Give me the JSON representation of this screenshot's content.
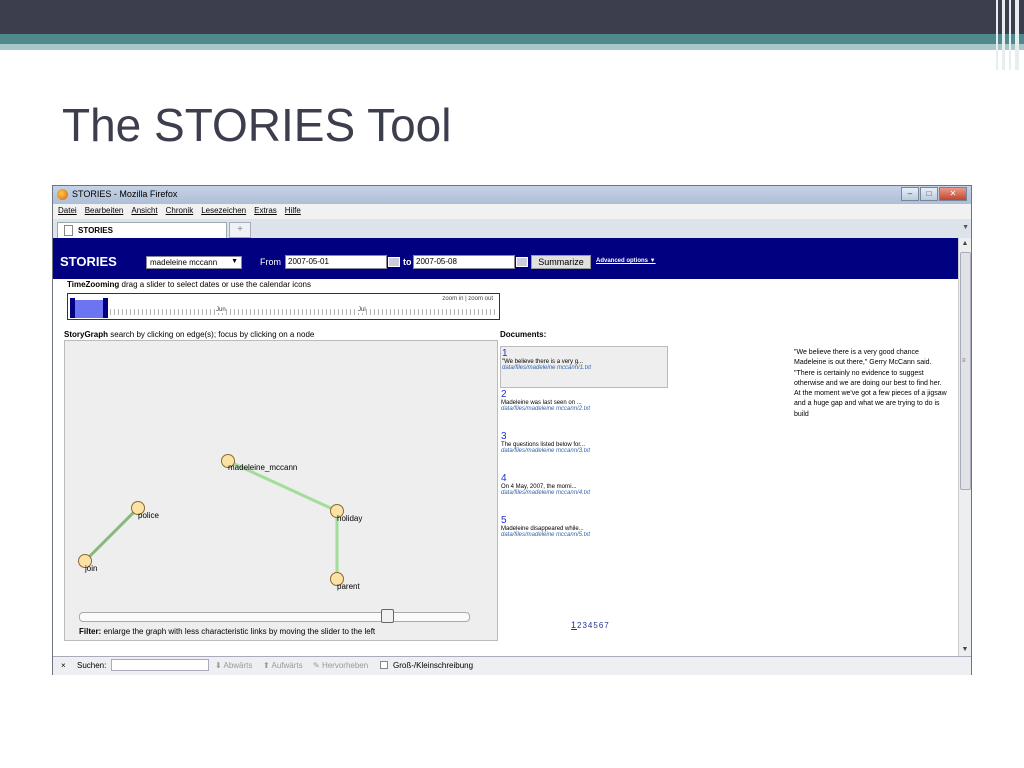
{
  "slide": {
    "title": "The STORIES Tool"
  },
  "window": {
    "title": "STORIES - Mozilla Firefox",
    "menu": [
      "Datei",
      "Bearbeiten",
      "Ansicht",
      "Chronik",
      "Lesezeichen",
      "Extras",
      "Hilfe"
    ],
    "tab_label": "STORIES",
    "new_tab_glyph": "+"
  },
  "header": {
    "brand": "STORIES",
    "dataset": "madeleine mccann",
    "from_label": "From",
    "from_date": "2007-05-01",
    "to_label": "to",
    "to_date": "2007-05-08",
    "summarize_label": "Summarize",
    "advanced_label": "Advanced options ▼"
  },
  "timezoom": {
    "title_bold": "TimeZooming",
    "title_rest": " drag a slider to select dates or use the calendar icons",
    "zoom_label": "zoom in | zoom out",
    "months": [
      "Jun",
      "Jul"
    ]
  },
  "storygraph": {
    "title_bold": "StoryGraph",
    "title_rest": " search by clicking on edge(s); focus by clicking on a node",
    "nodes": [
      "madeleine_mccann",
      "holiday",
      "parent",
      "police",
      "join"
    ],
    "filter_bold": "Filter:",
    "filter_rest": " enlarge the graph with less characteristic links by moving the slider to the left",
    "filter_level": 0.8
  },
  "documents": {
    "title": "Documents:",
    "items": [
      {
        "num": "1",
        "snippet": "\"We believe there is a very g...",
        "path": "data/files/madeleine mccann/1.txt"
      },
      {
        "num": "2",
        "snippet": "Madeleine was last seen on ...",
        "path": "data/files/madeleine mccann/2.txt"
      },
      {
        "num": "3",
        "snippet": "The questions listed below for...",
        "path": "data/files/madeleine mccann/3.txt"
      },
      {
        "num": "4",
        "snippet": "On 4 May, 2007, the morni...",
        "path": "data/files/madeleine mccann/4.txt"
      },
      {
        "num": "5",
        "snippet": "Madeleine disappeared while...",
        "path": "data/files/madeleine mccann/5.txt"
      }
    ],
    "pages": [
      "1",
      "2",
      "3",
      "4",
      "5",
      "6",
      "7"
    ],
    "preview": "\"We believe there is a very good chance Madeleine is out there,\" Gerry McCann said. \"There is certainly no evidence to suggest otherwise and we are doing our best to find her. At the moment we've got a few pieces of a jigsaw and a huge gap and what we are trying to do is build"
  },
  "findbar": {
    "close_glyph": "×",
    "label": "Suchen:",
    "down_label": "Abwärts",
    "up_label": "Aufwärts",
    "highlight_label": "Hervorheben",
    "case_label": "Groß-/Kleinschreibung"
  }
}
